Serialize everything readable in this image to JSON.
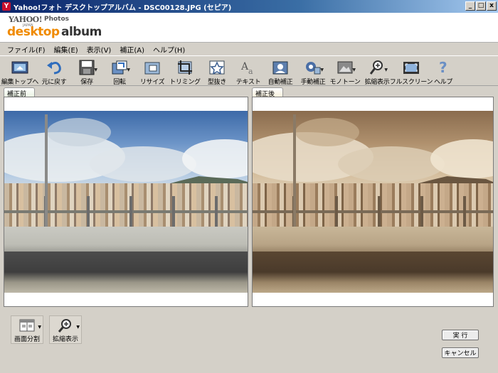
{
  "window": {
    "title": "Yahoo!フォト デスクトップアルバム - DSC00128.JPG (セピア)",
    "controls": [
      "_",
      "□",
      "x"
    ]
  },
  "brand": {
    "yahoo": "YAHOO!",
    "photos": "Photos",
    "japan": "JAPAN",
    "desktop": "desktop",
    "album": "album"
  },
  "menu": [
    "ファイル(F)",
    "編集(E)",
    "表示(V)",
    "補正(A)",
    "ヘルプ(H)"
  ],
  "toolbar": [
    {
      "label": "編集トップへ",
      "icon": "edit-top-icon",
      "dropdown": false
    },
    {
      "label": "元に戻す",
      "icon": "undo-icon",
      "dropdown": false
    },
    {
      "label": "保存",
      "icon": "save-icon",
      "dropdown": true
    },
    {
      "label": "回転",
      "icon": "rotate-icon",
      "dropdown": true
    },
    {
      "label": "リサイズ",
      "icon": "resize-icon",
      "dropdown": false
    },
    {
      "label": "トリミング",
      "icon": "trim-icon",
      "dropdown": false
    },
    {
      "label": "型抜き",
      "icon": "cutout-icon",
      "dropdown": false
    },
    {
      "label": "テキスト",
      "icon": "text-icon",
      "dropdown": false
    },
    {
      "label": "自動補正",
      "icon": "auto-correct-icon",
      "dropdown": false
    },
    {
      "label": "手動補正",
      "icon": "manual-correct-icon",
      "dropdown": true
    },
    {
      "label": "モノトーン",
      "icon": "monotone-icon",
      "dropdown": true
    },
    {
      "label": "拡縮表示",
      "icon": "zoom-icon",
      "dropdown": true
    },
    {
      "label": "フルスクリーン",
      "icon": "fullscreen-icon",
      "dropdown": false
    },
    {
      "label": "ヘルプ",
      "icon": "help-icon",
      "dropdown": false
    }
  ],
  "panes": {
    "before_label": "補正前",
    "after_label": "補正後"
  },
  "bottom_tools": [
    {
      "label": "画面分割",
      "icon": "split-view-icon"
    },
    {
      "label": "拡縮表示",
      "icon": "zoom-icon"
    }
  ],
  "buttons": {
    "run": "実 行",
    "cancel": "キャンセル"
  },
  "colors": {
    "title_bar": "#0a246a",
    "brand_orange": "#f08a00",
    "sepia": "#9a7a58"
  }
}
